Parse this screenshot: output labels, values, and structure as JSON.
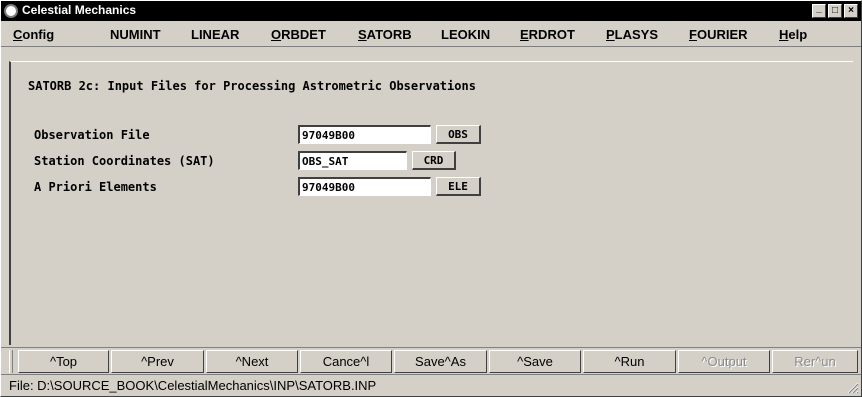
{
  "window": {
    "title": "Celestial Mechanics",
    "controls": {
      "minimize": "_",
      "maximize": "□",
      "close": "×"
    }
  },
  "menu": [
    {
      "label": "Config",
      "u": "C",
      "rest": "onfig"
    },
    {
      "label": "NUMINT",
      "u": "",
      "rest": "NUMINT"
    },
    {
      "label": "LINEAR",
      "u": "",
      "rest": "LINEAR"
    },
    {
      "label": "ORBDET",
      "u": "O",
      "rest": "RBDET"
    },
    {
      "label": "SATORB",
      "u": "S",
      "rest": "ATORB"
    },
    {
      "label": "LEOKIN",
      "u": "",
      "rest": "LEOKIN"
    },
    {
      "label": "ERDROT",
      "u": "E",
      "rest": "RDROT"
    },
    {
      "label": "PLASYS",
      "u": "P",
      "rest": "LASYS"
    },
    {
      "label": "FOURIER",
      "u": "F",
      "rest": "OURIER"
    },
    {
      "label": "Help",
      "u": "H",
      "rest": "elp"
    }
  ],
  "panel": {
    "title": "SATORB 2c: Input Files for Processing Astrometric Observations",
    "fields": [
      {
        "label": "Observation File",
        "value": "97049B00",
        "button": "OBS"
      },
      {
        "label": "Station Coordinates (SAT)",
        "value": "OBS_SAT",
        "button": "CRD"
      },
      {
        "label": "A Priori Elements",
        "value": "97049B00",
        "button": "ELE"
      }
    ]
  },
  "buttons": [
    {
      "label": "^Top",
      "enabled": true
    },
    {
      "label": "^Prev",
      "enabled": true
    },
    {
      "label": "^Next",
      "enabled": true
    },
    {
      "label": "Cance^l",
      "enabled": true
    },
    {
      "label": "Save^As",
      "enabled": true
    },
    {
      "label": "^Save",
      "enabled": true
    },
    {
      "label": "^Run",
      "enabled": true
    },
    {
      "label": "^Output",
      "enabled": false
    },
    {
      "label": "Rer^un",
      "enabled": false
    }
  ],
  "status": {
    "text": "File: D:\\SOURCE_BOOK\\CelestialMechanics\\INP\\SATORB.INP"
  }
}
